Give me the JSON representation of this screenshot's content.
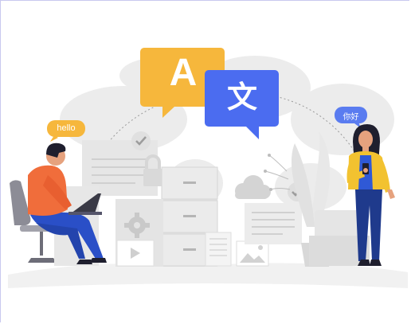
{
  "illustration": {
    "labels": {
      "speech_left": "hello",
      "speech_right": "你好",
      "translate_latin": "A",
      "translate_cjk": "文"
    },
    "colors": {
      "orange_bubble": "#f5b83d",
      "blue_bubble": "#4f6ef2",
      "small_blue_bubble": "#5a7cf0",
      "man_sweater": "#f06d3b",
      "man_pants": "#2a4fc7",
      "woman_jacket": "#f2c230",
      "woman_shirt": "#2f59d6",
      "woman_pants": "#1f3a8c",
      "hair": "#1f1f2e",
      "skin": "#e6a27e",
      "furniture_grey": "#e2e2e2",
      "chair_grey": "#8c8c96"
    },
    "icons": [
      "check-icon",
      "lock-icon",
      "gear-icon",
      "play-icon",
      "cloud-icon",
      "image-icon",
      "laptop-icon",
      "phone-icon",
      "world-map-icon"
    ]
  }
}
